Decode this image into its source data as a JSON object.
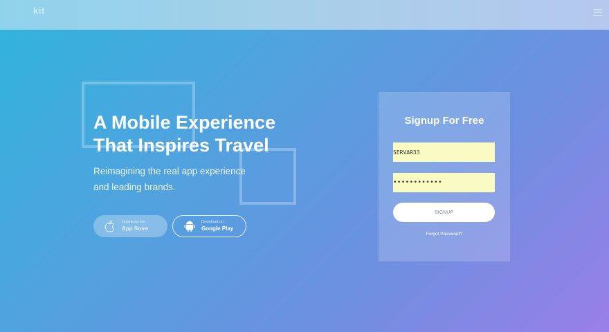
{
  "header": {
    "brand": "kit",
    "menu_icon": "hamburger-menu-icon"
  },
  "hero": {
    "title": "A Mobile Experience\nThat Inspires Travel",
    "subtitle": "Reimagining the real app experience\nand leading brands."
  },
  "store_buttons": [
    {
      "small": "Download the",
      "label": "App Store",
      "icon": "apple-icon"
    },
    {
      "small": "Download on",
      "label": "Google Play",
      "icon": "android-icon"
    }
  ],
  "signup": {
    "title": "Signup For Free",
    "username_value": "SERVAR33",
    "password_value": "••••••••••••",
    "button_label": "SIGNUP",
    "forgot_label": "Forgot Password?"
  },
  "colors": {
    "gradient_start": "#2fb5db",
    "gradient_end": "#9a7fe6",
    "input_bg": "#fafac3"
  }
}
